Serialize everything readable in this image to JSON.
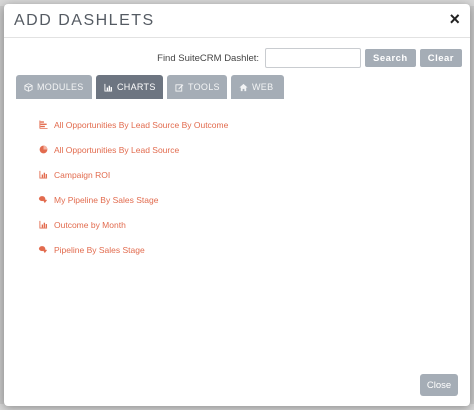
{
  "dialog": {
    "title": "ADD DASHLETS",
    "close_symbol": "×"
  },
  "search": {
    "label": "Find SuiteCRM Dashlet:",
    "value": "",
    "placeholder": "",
    "search_button": "Search",
    "clear_button": "Clear"
  },
  "tabs": [
    {
      "label": "MODULES",
      "icon": "cube-icon",
      "active": false
    },
    {
      "label": "CHARTS",
      "icon": "bar-chart-icon",
      "active": true
    },
    {
      "label": "TOOLS",
      "icon": "edit-icon",
      "active": false
    },
    {
      "label": "WEB",
      "icon": "home-icon",
      "active": false
    }
  ],
  "dashlets": [
    {
      "label": "All Opportunities By Lead Source By Outcome",
      "icon": "horizontal-bar-chart-icon"
    },
    {
      "label": "All Opportunities By Lead Source",
      "icon": "pie-chart-icon"
    },
    {
      "label": "Campaign ROI",
      "icon": "bar-chart-icon"
    },
    {
      "label": "My Pipeline By Sales Stage",
      "icon": "funnel-chart-icon"
    },
    {
      "label": "Outcome by Month",
      "icon": "bar-chart-icon"
    },
    {
      "label": "Pipeline By Sales Stage",
      "icon": "funnel-chart-icon"
    }
  ],
  "footer": {
    "close_button": "Close"
  },
  "colors": {
    "accent_link": "#e26b4e",
    "tab_active": "#6d7581",
    "tab_inactive": "#a5adb6",
    "button": "#a5adb6"
  }
}
